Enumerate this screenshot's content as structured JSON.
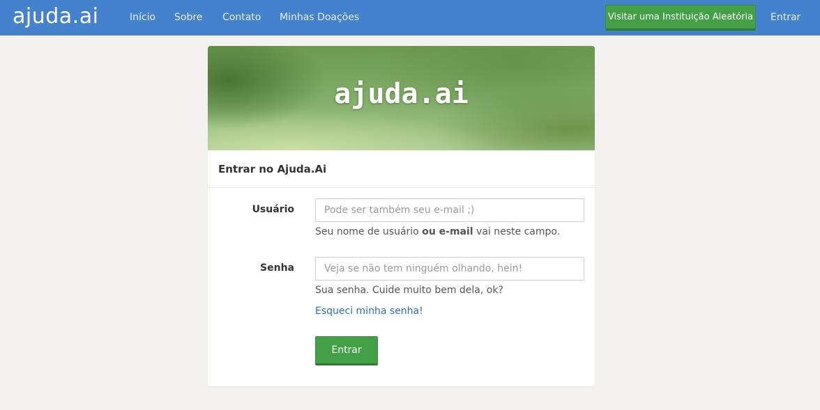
{
  "navbar": {
    "brand": "ajuda.ai",
    "links": [
      "Início",
      "Sobre",
      "Contato",
      "Minhas Doações"
    ],
    "random_button": "Visitar uma Instituição Aleatória",
    "login_link": "Entrar",
    "color": "#4582cd"
  },
  "card": {
    "banner_title": "ajuda.ai",
    "heading": "Entrar no Ajuda.Ai",
    "username": {
      "label": "Usuário",
      "placeholder": "Pode ser também seu e-mail ;)",
      "help_prefix": "Seu nome de usuário ",
      "help_bold": "ou e-mail",
      "help_suffix": " vai neste campo."
    },
    "password": {
      "label": "Senha",
      "placeholder": "Veja se não tem ninguém olhando, hein!",
      "help": "Sua senha. Cuide muito bem dela, ok?"
    },
    "forgot_link": "Esqueci minha senha!",
    "submit_label": "Entrar",
    "accent": "#43a047"
  }
}
